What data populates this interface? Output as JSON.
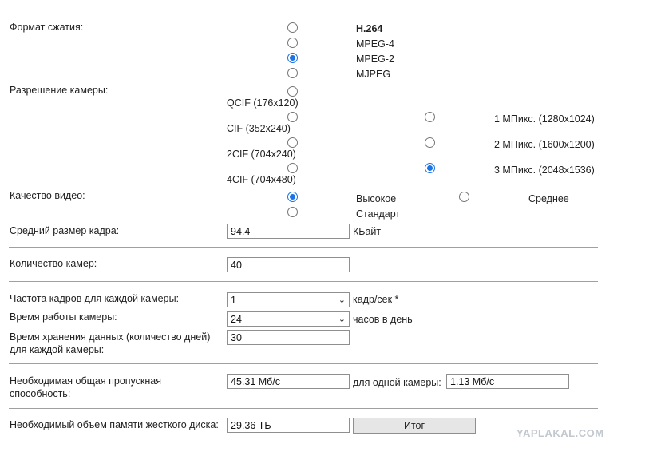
{
  "compression": {
    "label": "Формат сжатия:",
    "options": [
      "H.264",
      "MPEG-4",
      "MPEG-2",
      "MJPEG"
    ],
    "selected": "MPEG-2"
  },
  "resolution": {
    "label": "Разрешение камеры:",
    "left_options": [
      "QCIF (176x120)",
      "CIF (352x240)",
      "2CIF (704x240)",
      "4CIF (704x480)"
    ],
    "right_options": [
      "1 МПикс. (1280x1024)",
      "2 МПикс. (1600x1200)",
      "3 МПикс. (2048x1536)"
    ],
    "selected": "3 МПикс. (2048x1536)"
  },
  "quality": {
    "label": "Качество видео:",
    "options": [
      "Высокое",
      "Среднее",
      "Стандарт"
    ],
    "selected": "Высокое"
  },
  "frame_size": {
    "label": "Средний размер кадра:",
    "value": "94.4",
    "unit": "КБайт"
  },
  "cameras": {
    "label": "Количество камер:",
    "value": "40"
  },
  "fps": {
    "label": "Частота кадров для каждой камеры:",
    "value": "1",
    "unit": "кадр/сек *"
  },
  "work_time": {
    "label": "Время работы камеры:",
    "value": "24",
    "unit": "часов в день"
  },
  "retention": {
    "label_line1": "Время хранения данных (количество дней)",
    "label_line2": "для каждой камеры:",
    "value": "30"
  },
  "bandwidth": {
    "label_line1": "Необходимая общая пропускная",
    "label_line2": "способность:",
    "value": "45.31 Мб/с",
    "per_camera_label": "для одной камеры:",
    "per_camera_value": "1.13 Мб/с"
  },
  "disk": {
    "label": "Необходимый объем памяти жесткого диска:",
    "value": "29.36 ТБ"
  },
  "total_button": "Итог",
  "watermark": "YAPLAKAL.COM",
  "colors": {
    "accent": "#1a73e8",
    "divider": "#a0a0a0"
  }
}
